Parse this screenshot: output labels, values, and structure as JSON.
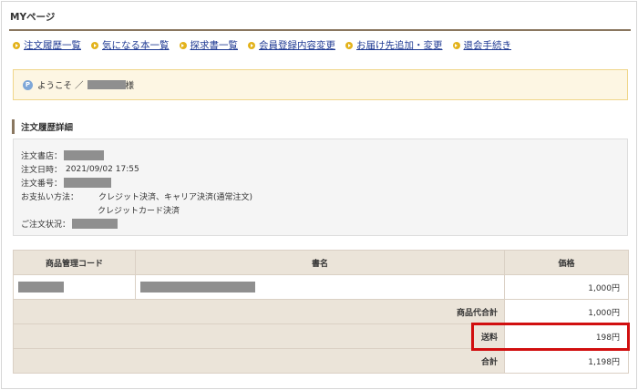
{
  "page": {
    "title": "MYページ"
  },
  "nav": [
    {
      "label": "注文履歴一覧"
    },
    {
      "label": "気になる本一覧"
    },
    {
      "label": "探求書一覧"
    },
    {
      "label": "会員登録内容変更"
    },
    {
      "label": "お届け先追加・変更"
    },
    {
      "label": "退会手続き"
    }
  ],
  "welcome": {
    "icon_text": "P",
    "prefix": "ようこそ ／",
    "suffix": "様"
  },
  "section": {
    "title": "注文履歴詳細"
  },
  "order": {
    "store_label": "注文書店：",
    "date_label": "注文日時：",
    "date_value": "2021/09/02 17:55",
    "number_label": "注文番号：",
    "payment_label": "お支払い方法：",
    "payment_value_1": "クレジット決済、キャリア決済(通常注文)",
    "payment_value_2": "クレジットカード決済",
    "status_label": "ご注文状況："
  },
  "table": {
    "headers": {
      "code": "商品管理コード",
      "title": "書名",
      "price": "価格"
    },
    "item_price": "1,000円",
    "subtotal_label": "商品代合計",
    "subtotal_value": "1,000円",
    "shipping_label": "送料",
    "shipping_value": "198円",
    "total_label": "合計",
    "total_value": "1,198円"
  },
  "colors": {
    "accent": "#8a7760",
    "link": "#1f3a93",
    "bullet": "#e3b21a",
    "highlight": "#d10f0f"
  }
}
